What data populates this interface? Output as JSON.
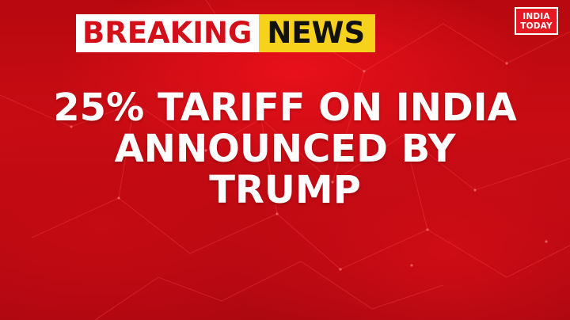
{
  "banner": {
    "breaking_label": "BREAKING",
    "news_label": "NEWS"
  },
  "logo": {
    "line1": "INDIA",
    "line2": "TODAY"
  },
  "headline": {
    "lines": [
      "25% TARIFF ON INDIA",
      "ANNOUNCED BY",
      "TRUMP"
    ]
  },
  "colors": {
    "background": "#c90c14",
    "breaking_text": "#d3101a",
    "news_background": "#f6d21c",
    "headline_text": "#ffffff"
  }
}
